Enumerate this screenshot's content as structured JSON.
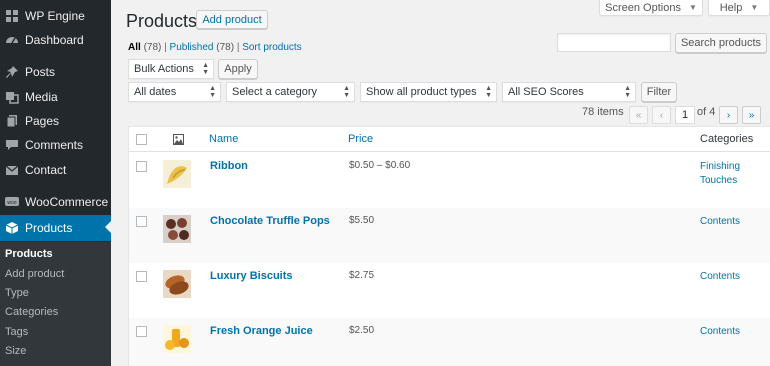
{
  "sidebar": {
    "site_name": "WP Engine",
    "items": [
      {
        "label": "Dashboard",
        "icon": "dashboard-icon"
      },
      {
        "label": "Posts",
        "icon": "pin-icon"
      },
      {
        "label": "Media",
        "icon": "media-icon"
      },
      {
        "label": "Pages",
        "icon": "pages-icon"
      },
      {
        "label": "Comments",
        "icon": "comments-icon"
      },
      {
        "label": "Contact",
        "icon": "mail-icon"
      },
      {
        "label": "WooCommerce",
        "icon": "woo-icon"
      },
      {
        "label": "Products",
        "icon": "box-icon"
      }
    ],
    "submenu": [
      "Products",
      "Add product",
      "Type",
      "Categories",
      "Tags",
      "Size"
    ]
  },
  "header": {
    "title": "Products",
    "add_button": "Add product",
    "screen_options": "Screen Options",
    "help": "Help"
  },
  "filters_status": {
    "all": "All",
    "all_count": "(78)",
    "published": "Published",
    "published_count": "(78)",
    "sort": "Sort products",
    "sep": "|"
  },
  "search": {
    "value": "",
    "button": "Search products"
  },
  "bulk": {
    "select": "Bulk Actions",
    "apply": "Apply"
  },
  "filter_selects": {
    "dates": "All dates",
    "category": "Select a category",
    "types": "Show all product types",
    "seo": "All SEO Scores",
    "filter_button": "Filter"
  },
  "pagination": {
    "items": "78 items",
    "first": "«",
    "prev": "‹",
    "current": "1",
    "of": "of 4",
    "next": "›",
    "last": "»"
  },
  "table": {
    "columns": {
      "image": "image-icon",
      "name": "Name",
      "price": "Price",
      "categories": "Categories"
    },
    "rows": [
      {
        "name": "Ribbon",
        "price": "$0.50 – $0.60",
        "categories": "Finishing Touches",
        "thumb_color": "#e8c24a"
      },
      {
        "name": "Chocolate Truffle Pops",
        "price": "$5.50",
        "categories": "Contents",
        "thumb_color": "#8a4a3a"
      },
      {
        "name": "Luxury Biscuits",
        "price": "$2.75",
        "categories": "Contents",
        "thumb_color": "#b5652a"
      },
      {
        "name": "Fresh Orange Juice",
        "price": "$2.50",
        "categories": "Contents",
        "thumb_color": "#f0a81c"
      }
    ]
  },
  "colors": {
    "sidebar_bg": "#23282d",
    "accent": "#0073aa",
    "page_bg": "#f1f1f1"
  }
}
